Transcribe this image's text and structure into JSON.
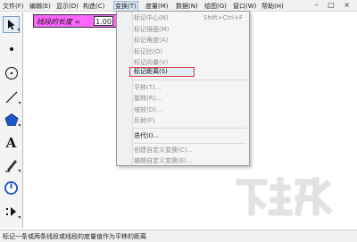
{
  "menubar": {
    "items": [
      "文件(F)",
      "编辑(E)",
      "显示(D)",
      "构造(C)",
      "变换(T)",
      "度量(M)",
      "数据(N)",
      "绘图(G)",
      "窗口(W)",
      "帮助(H)"
    ],
    "active_index": 4,
    "window_buttons": "– □ ×"
  },
  "toolbox": {
    "tools": [
      {
        "icon": "arrow-select-icon",
        "selected": true
      },
      {
        "icon": "point-tool-icon"
      },
      {
        "icon": "compass-circle-icon"
      },
      {
        "icon": "straightedge-icon"
      },
      {
        "icon": "polygon-tool-icon"
      },
      {
        "icon": "text-tool-icon",
        "glyph": "A"
      },
      {
        "icon": "marker-pen-icon"
      },
      {
        "icon": "info-tool-icon",
        "glyph": "i"
      },
      {
        "icon": "custom-tool-icon"
      }
    ]
  },
  "measurement": {
    "label": "线段的长度 =",
    "value": "1.00",
    "unit": "厘"
  },
  "transform_menu": {
    "items": [
      {
        "label": "标记中心(N)",
        "shortcut": "Shift+Ctrl+F",
        "enabled": false
      },
      {
        "label": "标记镜面(M)",
        "enabled": false
      },
      {
        "label": "标记角度(A)",
        "enabled": false
      },
      {
        "label": "标记比(O)",
        "enabled": false
      },
      {
        "label": "标记向量(V)",
        "enabled": false
      },
      {
        "label": "标记距离(S)",
        "enabled": true,
        "highlighted": true
      },
      {
        "label": "平移(T)...",
        "enabled": false
      },
      {
        "label": "旋转(R)...",
        "enabled": false
      },
      {
        "label": "缩放(D)...",
        "enabled": false
      },
      {
        "label": "反射(F)",
        "enabled": false
      },
      {
        "label": "迭代(I)...",
        "enabled": true
      },
      {
        "label": "创建自定义变换(C)...",
        "enabled": false
      },
      {
        "label": "编辑自定义变换(E)...",
        "enabled": false
      }
    ]
  },
  "status": {
    "text": "标记一条或两条线段或线段的度量值作为平移的距离"
  },
  "colors": {
    "measurement_bg": "#ff66ff",
    "highlight_border": "#d23a3a"
  }
}
